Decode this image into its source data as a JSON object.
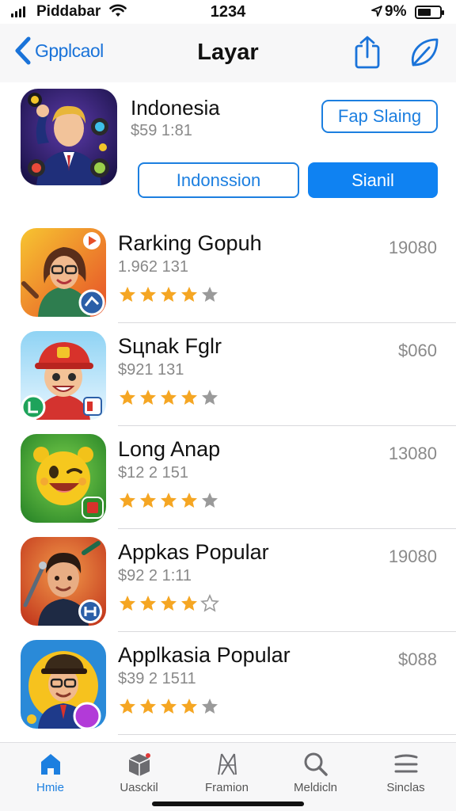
{
  "status_bar": {
    "carrier": "Piddabar",
    "time": "1234",
    "battery_percent": "9%",
    "battery_level": 0.6
  },
  "nav": {
    "back_label": "Gpplcaol",
    "title": "Layar"
  },
  "featured": {
    "title": "Indonesia",
    "subtitle": "$59 1:81",
    "get_button": "Fap Slaing",
    "segment_left": "Indonssion",
    "segment_right": "Sianil"
  },
  "apps": [
    {
      "title": "Rarking Gopuh",
      "subtitle": "1.962 131",
      "price": "19080",
      "rating": 4
    },
    {
      "title": "Sцnak Fglr",
      "subtitle": "$921 131",
      "price": "$060",
      "rating": 4
    },
    {
      "title": "Long Anap",
      "subtitle": "$12 2 151",
      "price": "13080",
      "rating": 4
    },
    {
      "title": "Appkas Popular",
      "subtitle": "$92 2 1:11",
      "price": "19080",
      "rating": 4
    },
    {
      "title": "Applkasia Popular",
      "subtitle": "$39 2 1511",
      "price": "$088",
      "rating": 4
    }
  ],
  "tabs": [
    {
      "label": "Hmie",
      "icon": "home-icon",
      "active": true
    },
    {
      "label": "Uasckil",
      "icon": "box-icon",
      "active": false
    },
    {
      "label": "Framion",
      "icon": "frame-icon",
      "active": false
    },
    {
      "label": "Meldicln",
      "icon": "search-icon",
      "active": false
    },
    {
      "label": "Sinclas",
      "icon": "menu-icon",
      "active": false
    }
  ],
  "colors": {
    "accent": "#1c7fe0",
    "star": "#f5a623",
    "star_empty": "#9a9a9a"
  }
}
